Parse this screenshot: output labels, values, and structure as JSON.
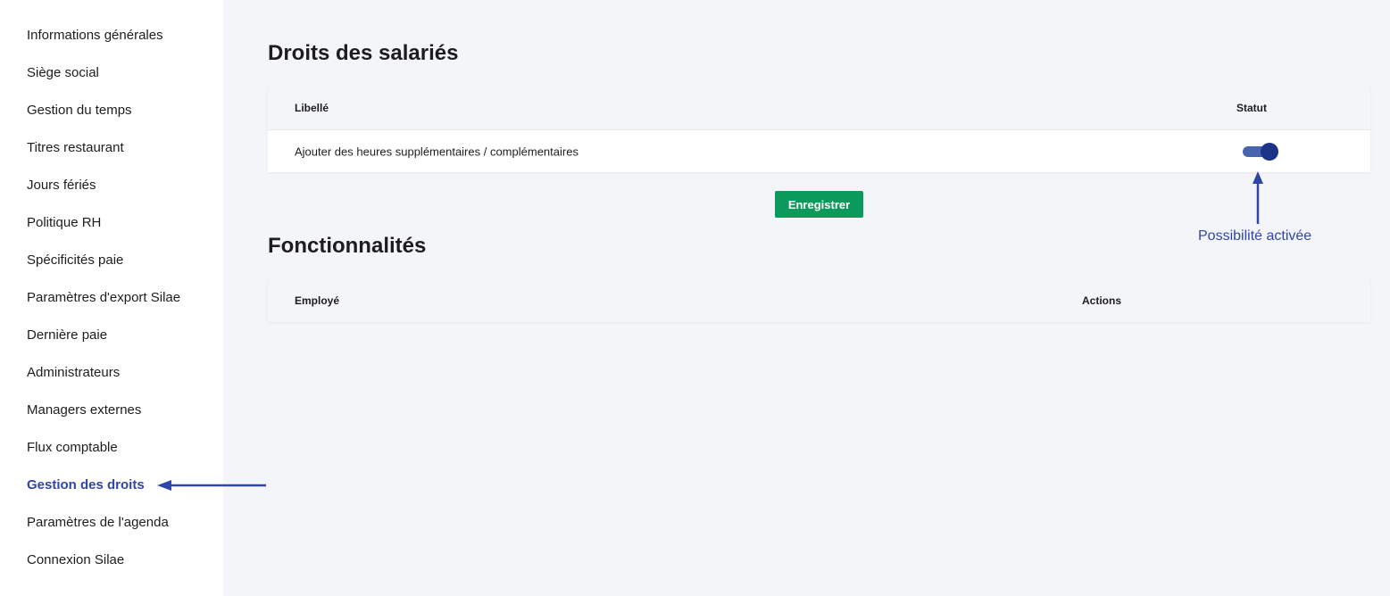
{
  "sidebar": {
    "items": [
      {
        "label": "Informations générales",
        "active": false
      },
      {
        "label": "Siège social",
        "active": false
      },
      {
        "label": "Gestion du temps",
        "active": false
      },
      {
        "label": "Titres restaurant",
        "active": false
      },
      {
        "label": "Jours fériés",
        "active": false
      },
      {
        "label": "Politique RH",
        "active": false
      },
      {
        "label": "Spécificités paie",
        "active": false
      },
      {
        "label": "Paramètres d'export Silae",
        "active": false
      },
      {
        "label": "Dernière paie",
        "active": false
      },
      {
        "label": "Administrateurs",
        "active": false
      },
      {
        "label": "Managers externes",
        "active": false
      },
      {
        "label": "Flux comptable",
        "active": false
      },
      {
        "label": "Gestion des droits",
        "active": true
      },
      {
        "label": "Paramètres de l'agenda",
        "active": false
      },
      {
        "label": "Connexion Silae",
        "active": false
      }
    ]
  },
  "rights": {
    "title": "Droits des salariés",
    "columns": {
      "label": "Libellé",
      "status": "Statut"
    },
    "rows": [
      {
        "label": "Ajouter des heures supplémentaires / complémentaires",
        "enabled": true
      }
    ],
    "save_label": "Enregistrer"
  },
  "features": {
    "title": "Fonctionnalités",
    "columns": {
      "employee": "Employé",
      "actions": "Actions"
    }
  },
  "annotation": {
    "text": "Possibilité activée"
  },
  "colors": {
    "accent": "#2f46a6",
    "toggle_knob": "#1c3488",
    "toggle_track": "#4a63ad",
    "save_button": "#0b9a5b",
    "background": "#f4f5f9"
  }
}
